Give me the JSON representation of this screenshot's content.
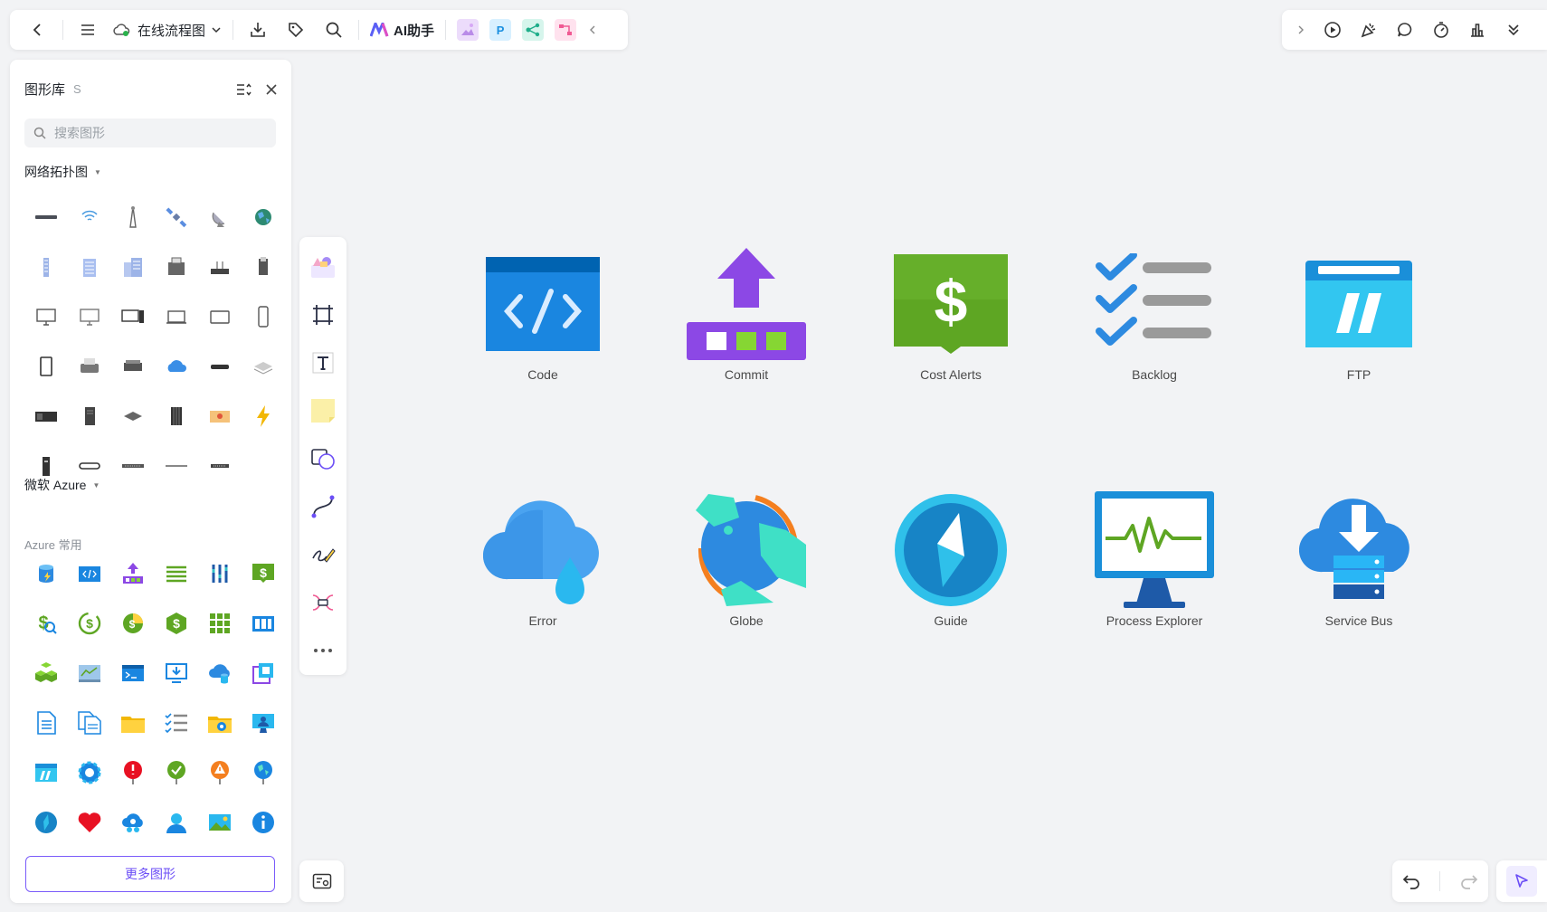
{
  "toolbar": {
    "doc_title": "在线流程图",
    "ai_label": "AI助手",
    "plugin_p": "P"
  },
  "library": {
    "title": "图形库",
    "shortcut": "S",
    "search_placeholder": "搜索图形",
    "section_network": "网络拓扑图",
    "section_azure": "微软 Azure",
    "azure_sub": "Azure 常用",
    "more_button": "更多图形"
  },
  "canvas": {
    "shapes": [
      {
        "label": "Code"
      },
      {
        "label": "Commit"
      },
      {
        "label": "Cost Alerts"
      },
      {
        "label": "Backlog"
      },
      {
        "label": "FTP"
      },
      {
        "label": "Error"
      },
      {
        "label": "Globe"
      },
      {
        "label": "Guide"
      },
      {
        "label": "Process Explorer"
      },
      {
        "label": "Service Bus"
      }
    ]
  },
  "colors": {
    "accent": "#6b4ef6",
    "azure_blue": "#0f78d4",
    "green": "#5ea623",
    "purple": "#8c48e5"
  }
}
